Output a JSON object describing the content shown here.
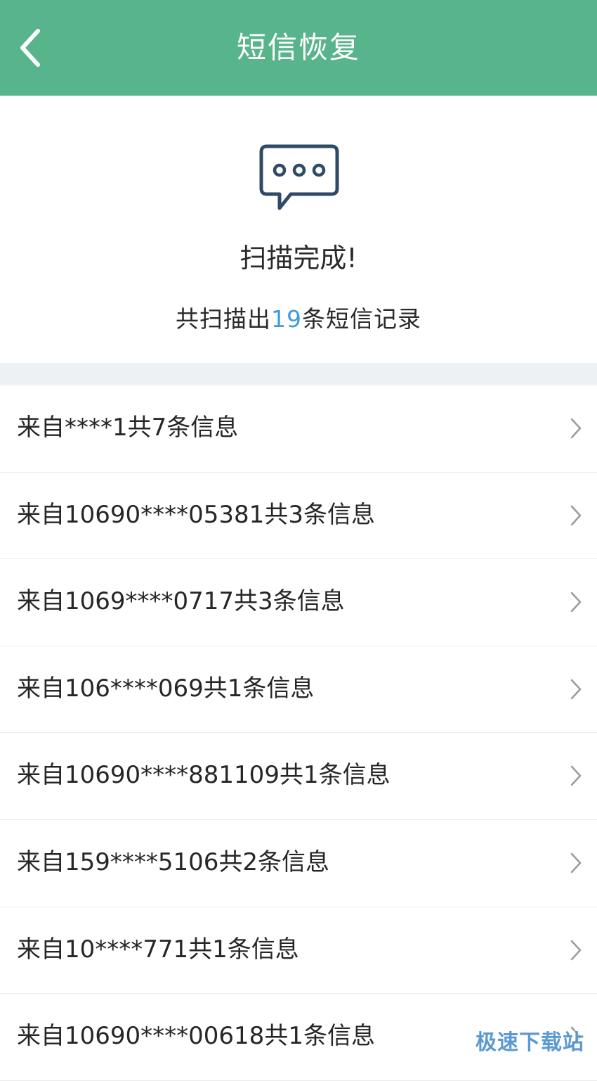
{
  "header": {
    "title": "短信恢复",
    "back_icon": "chevron-left-icon",
    "bg_color": "#58b48b"
  },
  "summary": {
    "icon": "chat-bubble-dots-icon",
    "status": "扫描完成!",
    "count_prefix": "共扫描出",
    "count_value": "19",
    "count_suffix": "条短信记录",
    "accent_color": "#3d9be0"
  },
  "list": {
    "items": [
      {
        "label": "来自****1共7条信息"
      },
      {
        "label": "来自10690****05381共3条信息"
      },
      {
        "label": "来自1069****0717共3条信息"
      },
      {
        "label": "来自106****069共1条信息"
      },
      {
        "label": "来自10690****881109共1条信息"
      },
      {
        "label": "来自159****5106共2条信息"
      },
      {
        "label": "来自10****771共1条信息"
      },
      {
        "label": "来自10690****00618共1条信息"
      }
    ],
    "chevron_icon": "chevron-right-icon"
  },
  "watermark": {
    "text": "极速下载站"
  }
}
